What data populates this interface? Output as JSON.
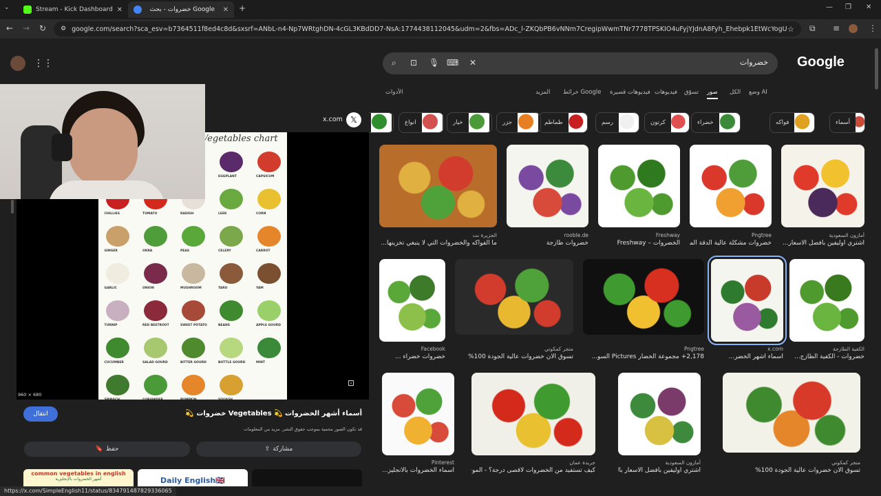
{
  "browser": {
    "tabs": [
      {
        "title": "Stream - Kick Dashboard",
        "favicon_color": "#53fc18"
      },
      {
        "title": "خضروات - بحث Google",
        "favicon_color": "#4285f4"
      }
    ],
    "new_tab": "+",
    "url": "google.com/search?sca_esv=b7364511f8ed4c8d&sxsrf=ANbL-n4-Np7WRtghDN-4cGL3KBdDD7-NsA:1774438112045&udm=2&fbs=ADc_l-ZKQbPB6vNNm7CregipWwmTNr7778TPSKIO4uFyjYJdnA8Fyh_Ehebpk1EtWcYogUeOFm5yShtBlCELfB2Rqk7nh..."
  },
  "google": {
    "logo": "Google",
    "query": "خضروات",
    "nav": [
      "وضع AI",
      "الكل",
      "صور",
      "تسوّق",
      "فيديوهات",
      "فيديوهات قصيرة",
      "خرائط Google",
      "المزيد",
      "الأدوات"
    ],
    "chips": [
      {
        "label": "أسماء",
        "color": "#c94b3a"
      },
      {
        "label": "فواكه",
        "color": "#e0a020"
      },
      {
        "label": "خضراء",
        "color": "#3a8a3a"
      },
      {
        "label": "كرتون",
        "color": "#e15050"
      },
      {
        "label": "رسم",
        "color": "#f0f0f0"
      },
      {
        "label": "طماطم",
        "color": "#c82020"
      },
      {
        "label": "جزر",
        "color": "#e67e22"
      },
      {
        "label": "خيار",
        "color": "#4a9a3a"
      },
      {
        "label": "انواع",
        "color": "#d35050"
      },
      {
        "label": "فلفل",
        "color": "#2f8f2f"
      }
    ],
    "grid": [
      {
        "source": "الجزيرة نت",
        "title": "ما الفواكه والخضروات التي لا ينبغي تخزينها...",
        "colors": [
          "#b86d2a",
          "#e0b040",
          "#d23c2c",
          "#4fa23a"
        ]
      },
      {
        "source": "rooble.de",
        "title": "خضروات طازجة",
        "colors": [
          "#f5f5f0",
          "#7a4aa0",
          "#3c8a3c",
          "#d84a3a"
        ]
      },
      {
        "source": "Freshway",
        "title": "الخضروات – Freshway",
        "colors": [
          "#ffffff",
          "#4e9a2e",
          "#2f7a1e",
          "#6ab540"
        ]
      },
      {
        "source": "Pngtree",
        "title": "خضروات مشكلة عالية الدقة المواد ...",
        "colors": [
          "#ffffff",
          "#d9382b",
          "#4f9d3a",
          "#f0a030"
        ]
      },
      {
        "source": "أمازون السعودية",
        "title": "اشتري اوليفين بأفضل الاسعار...",
        "colors": [
          "#f5f2ea",
          "#e03a2a",
          "#f2c12e",
          "#4a2a5a"
        ]
      },
      {
        "source": "Facebook",
        "title": "خضروات خضراء ...",
        "colors": [
          "#ffffff",
          "#5aa83a",
          "#3d7a2a",
          "#8cc04a"
        ]
      },
      {
        "source": "متجر كمكوتي",
        "title": "تسوق الان خضروات عالية الجودة 100%",
        "colors": [
          "#2a2a2a",
          "#d23c2c",
          "#4fa23a",
          "#e8b830"
        ]
      },
      {
        "source": "Pngtree",
        "title": "2,178+ مجموعة الخضار Pictures السو...",
        "colors": [
          "#101010",
          "#3f9a2f",
          "#d83020",
          "#f0c030"
        ]
      },
      {
        "source": "x.com",
        "title": "أسماء أشهر الخضر...",
        "colors": [
          "#f5f5ef",
          "#2e7a2e",
          "#c83a2a",
          "#9a5aa0"
        ]
      },
      {
        "source": "الكفية الطازجة",
        "title": "خضروات - الكفية الطازج...",
        "colors": [
          "#ffffff",
          "#4e9a2e",
          "#3a7a1e",
          "#6ab540"
        ]
      },
      {
        "source": "Pinterest",
        "title": "أسماء الخضروات بالانجليز...",
        "colors": [
          "#fafafa",
          "#d84a3a",
          "#4fa23a",
          "#f0b030"
        ]
      },
      {
        "source": "جريدة عمان",
        "title": "كيف تستفيد من الخضروات لأقصى درجة؟ - الموقع ...",
        "colors": [
          "#f0f0e8",
          "#d42a1c",
          "#3f9a2f",
          "#e8c030"
        ]
      },
      {
        "source": "أمازون السعودية",
        "title": "اشتري اوليفين بأفضل الاسعار بالسو...",
        "colors": [
          "#ffffff",
          "#3d8a3d",
          "#7a3a6a",
          "#d8c040"
        ]
      },
      {
        "source": "متجر كمكوتي",
        "title": "تسوق الان خضروات عالية الجودة 100%",
        "colors": [
          "#f2f2e8",
          "#3f8a2f",
          "#d83a2a",
          "#e6862a"
        ]
      }
    ]
  },
  "preview": {
    "source": "x.com",
    "image_title": "Vegetables chart",
    "dimensions": "960 × 680",
    "title": "أسماء أشهر الخضروات 💫 Vegetables خضروات 💫",
    "notice": "قد تكون الصور محمية بموجب حقوق النشر. مزيد من المعلومات",
    "visit": "انتقال",
    "share": "مشاركة",
    "save": "حفظ",
    "related": [
      "common vegetables in english",
      "Daily English🇬🇧",
      ""
    ],
    "related_sub": "أشهر الخضروات بالإنجليزية",
    "veg_labels": [
      "CABBAGE",
      "RED CABBAGE",
      "POTATO",
      "EGGPLANT",
      "CAPSICUM",
      "CHILLIES",
      "TOMATO",
      "RADISH",
      "LEEK",
      "CORN",
      "GINGER",
      "OKRA",
      "PEAS",
      "CELERY",
      "CARROT",
      "GARLIC",
      "ONION",
      "MUSHROOM",
      "TARO",
      "YAM",
      "TURNIP",
      "RED BEETROOT",
      "SWEET POTATO",
      "BEANS",
      "APPLE GOURD",
      "CUCUMBER",
      "SALAD GOURD",
      "BITTER GOURD",
      "BOTTLE GOURD",
      "MINT",
      "SPINACH",
      "CORIANDER",
      "PUMPKIN",
      "SQUASH"
    ]
  },
  "status_url": "https://x.com/SimpleEnglish11/status/834791487829336065"
}
